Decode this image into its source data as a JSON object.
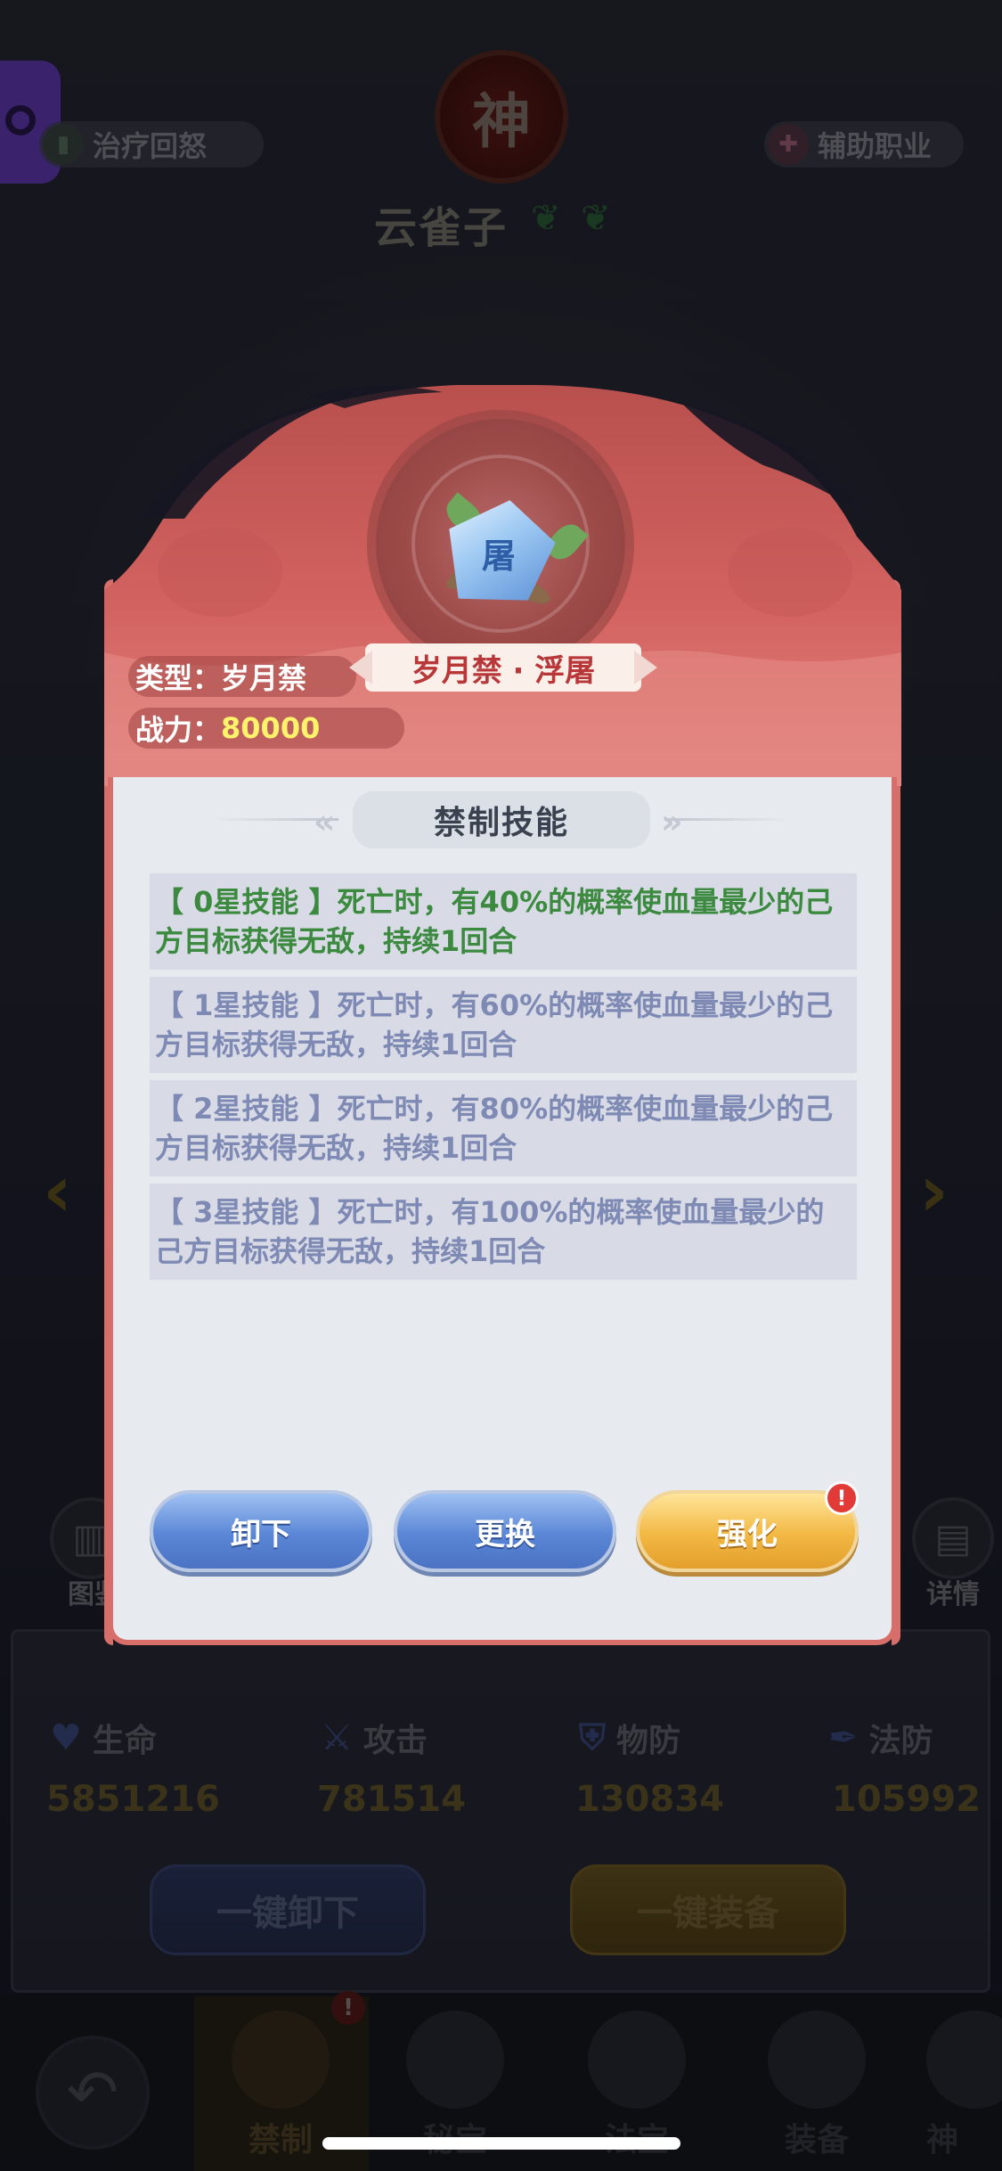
{
  "hero": {
    "badge": "神",
    "name": "云雀子",
    "tags": {
      "left": "治疗回怒",
      "right": "辅助职业"
    }
  },
  "side": {
    "left_label": "图鉴",
    "right_label": "详情"
  },
  "stats": [
    {
      "name": "生命",
      "value": "5851216"
    },
    {
      "name": "攻击",
      "value": "781514"
    },
    {
      "name": "物防",
      "value": "130834"
    },
    {
      "name": "法防",
      "value": "105992"
    }
  ],
  "actions": {
    "unequip_all": "一键卸下",
    "equip_all": "一键装备"
  },
  "nav": {
    "items": [
      "禁制",
      "秘宝",
      "法宝",
      "装备",
      "神"
    ],
    "badge": "!"
  },
  "modal": {
    "item_title": "岁月禁 · 浮屠",
    "gem_char": "屠",
    "type_label": "类型：",
    "type_value": "岁月禁",
    "power_label": "战力：",
    "power_value": "80000",
    "section_title": "禁制技能",
    "skills": [
      "【 0星技能 】死亡时，有40%的概率使血量最少的己方目标获得无敌，持续1回合",
      "【 1星技能 】死亡时，有60%的概率使血量最少的己方目标获得无敌，持续1回合",
      "【 2星技能 】死亡时，有80%的概率使血量最少的己方目标获得无敌，持续1回合",
      "【 3星技能 】死亡时，有100%的概率使血量最少的己方目标获得无敌，持续1回合"
    ],
    "buttons": {
      "unload": "卸下",
      "replace": "更换",
      "enhance": "强化"
    },
    "enhance_badge": "!"
  },
  "colors": {
    "modal_red": "#d76e6a",
    "active_skill_text": "#3b8a3f",
    "inactive_skill_text": "#7e8ab4",
    "power_value": "#fff36b"
  }
}
